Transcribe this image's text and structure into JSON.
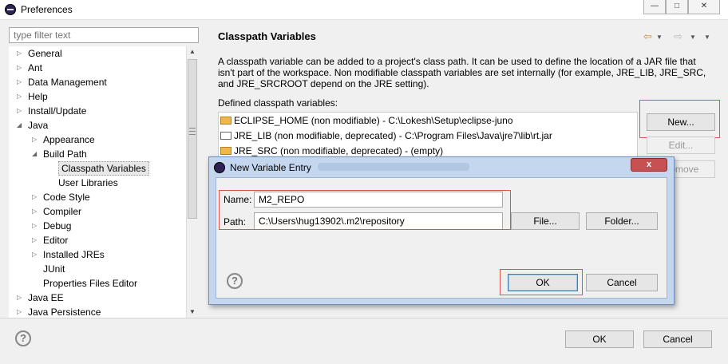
{
  "window": {
    "title": "Preferences",
    "min_symbol": "—",
    "max_symbol": "□",
    "close_symbol": "✕"
  },
  "filter": {
    "placeholder": "type filter text"
  },
  "tree": [
    {
      "label": "General",
      "expanded": false,
      "selected": false
    },
    {
      "label": "Ant",
      "expanded": false,
      "selected": false
    },
    {
      "label": "Data Management",
      "expanded": false,
      "selected": false
    },
    {
      "label": "Help",
      "expanded": false,
      "selected": false
    },
    {
      "label": "Install/Update",
      "expanded": false,
      "selected": false
    },
    {
      "label": "Java",
      "expanded": true,
      "selected": false
    },
    {
      "label": "Appearance",
      "expanded": false,
      "selected": false
    },
    {
      "label": "Build Path",
      "expanded": true,
      "selected": false
    },
    {
      "label": "Classpath Variables",
      "expanded": null,
      "selected": true
    },
    {
      "label": "User Libraries",
      "expanded": null,
      "selected": false
    },
    {
      "label": "Code Style",
      "expanded": false,
      "selected": false
    },
    {
      "label": "Compiler",
      "expanded": false,
      "selected": false
    },
    {
      "label": "Debug",
      "expanded": false,
      "selected": false
    },
    {
      "label": "Editor",
      "expanded": false,
      "selected": false
    },
    {
      "label": "Installed JREs",
      "expanded": false,
      "selected": false
    },
    {
      "label": "JUnit",
      "expanded": null,
      "selected": false
    },
    {
      "label": "Properties Files Editor",
      "expanded": null,
      "selected": false
    },
    {
      "label": "Java EE",
      "expanded": false,
      "selected": false
    },
    {
      "label": "Java Persistence",
      "expanded": false,
      "selected": false
    }
  ],
  "page": {
    "title": "Classpath Variables",
    "description": "A classpath variable can be added to a project's class path. It can be used to define the location of a JAR file that isn't part of the workspace. Non modifiable classpath variables are set internally (for example, JRE_LIB, JRE_SRC, and JRE_SRCROOT depend on the JRE setting).",
    "defined_label": "Defined classpath variables:",
    "variables": [
      {
        "text": "ECLIPSE_HOME (non modifiable) - C:\\Lokesh\\Setup\\eclipse-juno",
        "icon": "folder-icon"
      },
      {
        "text": "JRE_LIB (non modifiable, deprecated) - C:\\Program Files\\Java\\jre7\\lib\\rt.jar",
        "icon": "jar-icon"
      },
      {
        "text": "JRE_SRC (non modifiable, deprecated) - (empty)",
        "icon": "folder-icon"
      }
    ],
    "buttons": {
      "new": "New...",
      "edit": "Edit...",
      "remove": "Remove"
    }
  },
  "dialog": {
    "title": "New Variable Entry",
    "close_symbol": "x",
    "name_label": "Name:",
    "name_value": "M2_REPO",
    "path_label": "Path:",
    "path_value": "C:\\Users\\hug13902\\.m2\\repository",
    "file_button": "File...",
    "folder_button": "Folder...",
    "ok": "OK",
    "cancel": "Cancel",
    "help_symbol": "?"
  },
  "footer": {
    "ok": "OK",
    "cancel": "Cancel",
    "help_symbol": "?"
  },
  "colors": {
    "highlight_box": "#d9534f",
    "dialog_frame": "#c4d7ee",
    "close_red": "#c75050"
  }
}
